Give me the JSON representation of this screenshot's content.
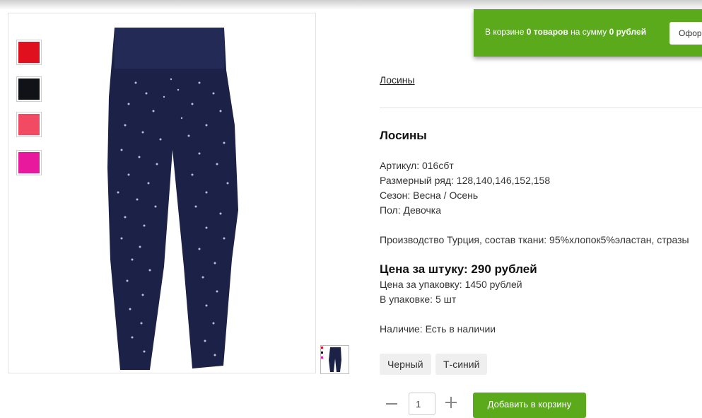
{
  "cart": {
    "prefix": "В корзине ",
    "count": "0 товаров",
    "middle": " на сумму ",
    "sum": "0 рублей",
    "checkout_label": "Оформить"
  },
  "gallery": {
    "swatches": [
      {
        "icon": "red-swatch-icon",
        "color": "#e0101e"
      },
      {
        "icon": "black-swatch-icon",
        "color": "#111118"
      },
      {
        "icon": "coral-swatch-icon",
        "color": "#f24a62"
      },
      {
        "icon": "pink-swatch-icon",
        "color": "#e8199c"
      }
    ],
    "product_color": "#1c2147"
  },
  "breadcrumb": "Лосины",
  "product": {
    "title": "Лосины",
    "article": "Артикул: 016сбт",
    "sizes": "Размерный ряд: 128,140,146,152,158",
    "season": "Сезон: Весна / Осень",
    "gender": "Пол: Девочка",
    "description": "Производство Турция, состав ткани: 95%хлопок5%эластан, стразы",
    "price_unit": "Цена за штуку: 290 рублей",
    "price_pack": "Цена за упаковку: 1450 рублей",
    "pack_qty": "В упаковке: 5 шт",
    "availability": "Наличие: Есть в наличии",
    "colors": [
      "Черный",
      "Т-синий"
    ]
  },
  "order": {
    "quantity": "1",
    "add_label": "Добавить в корзину"
  },
  "colors": {
    "accent": "#5aaa1c"
  }
}
